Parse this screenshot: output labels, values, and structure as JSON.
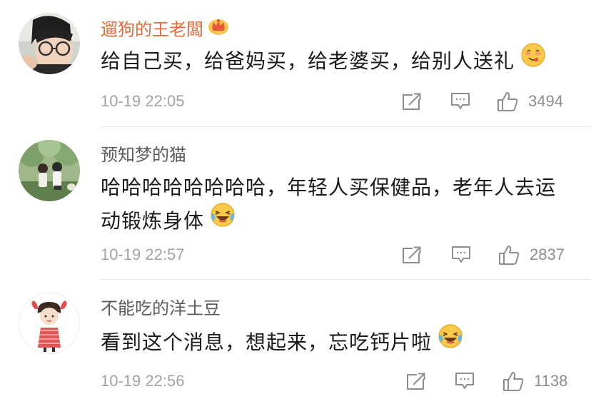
{
  "comments": [
    {
      "username": "遛狗的王老闆",
      "vip": true,
      "text": "给自己买，给爸妈买，给老婆买，给别人送礼",
      "emoji": "yummy-face-emoji",
      "timestamp": "10-19 22:05",
      "likes": "3494"
    },
    {
      "username": "预知梦的猫",
      "vip": false,
      "text": "哈哈哈哈哈哈哈哈，年轻人买保健品，老年人去运动锻炼身体",
      "emoji": "laughing-crying-emoji",
      "timestamp": "10-19 22:57",
      "likes": "2837"
    },
    {
      "username": "不能吃的洋土豆",
      "vip": false,
      "text": "看到这个消息，想起来，忘吃钙片啦",
      "emoji": "laughing-crying-emoji",
      "timestamp": "10-19 22:56",
      "likes": "1138"
    }
  ],
  "icons": {
    "share": "share-icon",
    "reply": "comment-icon",
    "like": "thumbs-up-icon"
  },
  "colors": {
    "vip_username": "#e8693a",
    "username": "#5c5c5c",
    "text": "#1a1a1a",
    "meta": "#a3a3a3",
    "divider": "#e6e6e6"
  }
}
